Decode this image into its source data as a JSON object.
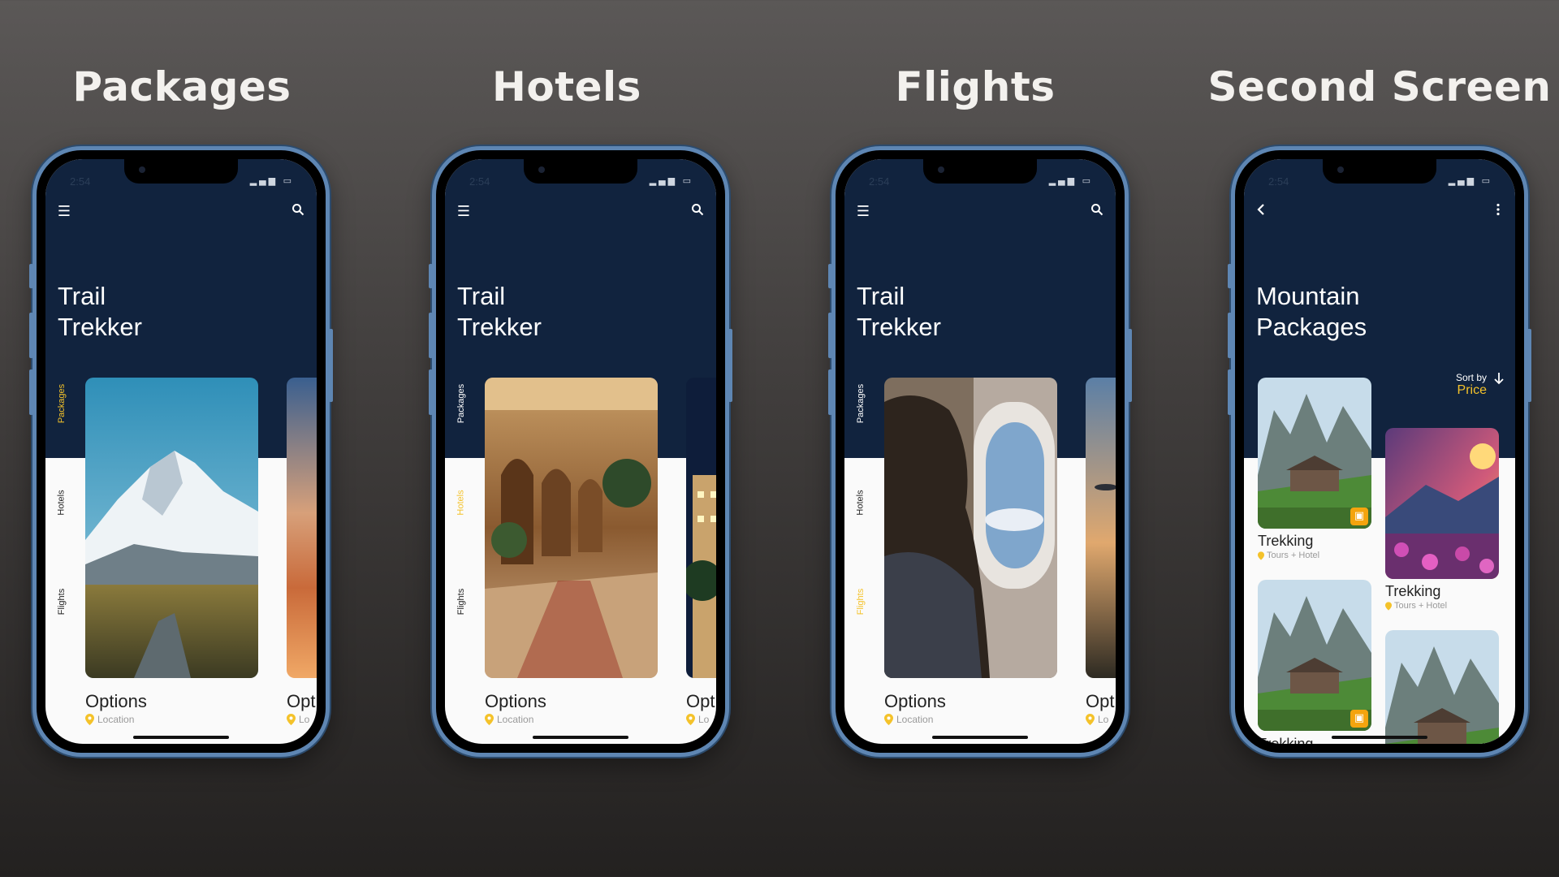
{
  "columns": [
    {
      "heading": "Packages"
    },
    {
      "heading": "Hotels"
    },
    {
      "heading": "Flights"
    },
    {
      "heading": "Second Screen"
    }
  ],
  "status_time": "2:54",
  "app_title_line1": "Trail",
  "app_title_line2": "Trekker",
  "tabs": {
    "packages": "Packages",
    "hotels": "Hotels",
    "flights": "Flights"
  },
  "card": {
    "title": "Options",
    "location": "Location",
    "side_title": "Opt",
    "side_location": "Lo"
  },
  "second_screen": {
    "title_line1": "Mountain",
    "title_line2": "Packages",
    "sort_by": "Sort by",
    "sort_value": "Price",
    "items": [
      {
        "title": "Trekking",
        "subtitle": "Tours + Hotel"
      },
      {
        "title": "Trekking",
        "subtitle": "Tours + Hotel"
      },
      {
        "title": "Trekking",
        "subtitle": ""
      }
    ]
  },
  "colors": {
    "navy": "#11233e",
    "accent": "#f4c22a",
    "frame": "#5e86b3",
    "badge": "#f4a40e"
  },
  "icons": [
    "menu-icon",
    "search-icon",
    "back-icon",
    "more-vertical-icon",
    "location-pin-icon",
    "calendar-icon",
    "sort-arrow-icon"
  ]
}
